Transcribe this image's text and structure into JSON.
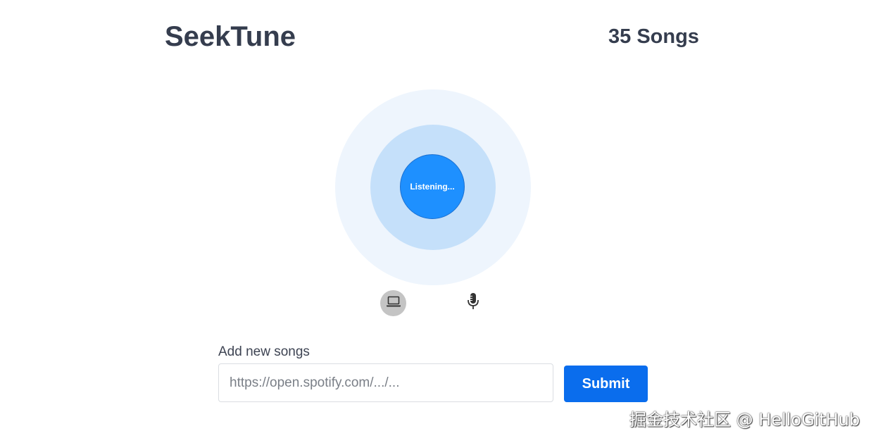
{
  "header": {
    "title": "SeekTune",
    "song_count": "35 Songs"
  },
  "listener": {
    "button_label": "Listening..."
  },
  "sources": [
    {
      "icon": "laptop-icon",
      "active": true
    },
    {
      "icon": "microphone-icon",
      "active": false
    }
  ],
  "add_songs": {
    "label": "Add new songs",
    "placeholder": "https://open.spotify.com/.../...",
    "submit_label": "Submit"
  },
  "watermark": {
    "text": "掘金技术社区 @ HelloGitHub"
  },
  "colors": {
    "accent": "#1e90ff",
    "submit": "#0a6ded",
    "ring_inner": "#c5e0fa",
    "ring_outer": "#eef5fd",
    "title": "#353d4e"
  }
}
